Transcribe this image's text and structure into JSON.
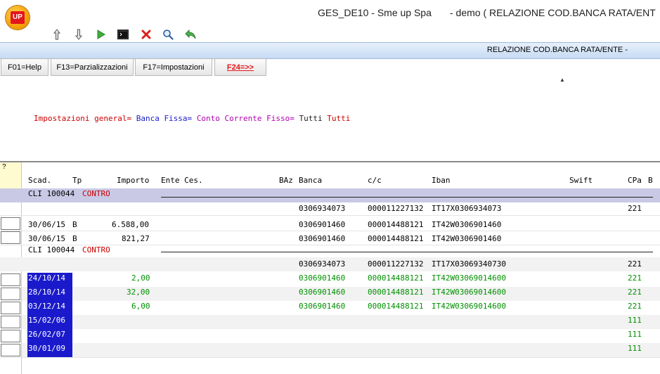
{
  "app": {
    "logo_text": "UP",
    "title": "GES_DE10 - Sme up Spa",
    "window_title": "- demo ( RELAZIONE COD.BANCA RATA/ENT"
  },
  "toolbar": {
    "icons": [
      "arrow-up-icon",
      "arrow-down-icon",
      "play-icon",
      "terminal-icon",
      "close-icon",
      "search-icon",
      "undo-icon"
    ]
  },
  "band": {
    "title": "RELAZIONE COD.BANCA RATA/ENTE -"
  },
  "function_keys": [
    "F01=Help",
    "F13=Parzializzazioni",
    "F17=Impostazioni",
    "F24=>>"
  ],
  "settings": {
    "label": "Impostazioni general=",
    "banca_label": "Banca Fissa=",
    "conto_label": "Conto Corrente Fisso=",
    "banca_value": "Tutti",
    "conto_value": "Tutti"
  },
  "grid": {
    "sel_header": "?",
    "columns": [
      "Scad.",
      "Tp",
      "Importo",
      "Ente Ces.",
      "BAz",
      "Banca",
      "c/c",
      "Iban",
      "Swift",
      "CPa",
      "B"
    ],
    "groups": [
      {
        "client": "CLI 100044",
        "tag": "CONTRO",
        "summary": {
          "banca": "0306934073",
          "cc": "000011227132",
          "iban": "IT17X0306934073",
          "cpa": "221"
        },
        "rows": [
          {
            "scad": "30/06/15",
            "tp": "B",
            "importo": "6.588,00",
            "banca": "0306901460",
            "cc": "000014488121",
            "iban": "IT42W0306901460",
            "cpa": ""
          },
          {
            "scad": "30/06/15",
            "tp": "B",
            "importo": "821,27",
            "banca": "0306901460",
            "cc": "000014488121",
            "iban": "IT42W0306901460",
            "cpa": ""
          }
        ]
      },
      {
        "client": "CLI 100044",
        "tag": "CONTRO",
        "summary": {
          "banca": "0306934073",
          "cc": "000011227132",
          "iban": "IT17X03069340730",
          "cpa": "221"
        },
        "rows": [
          {
            "scad": "24/10/14",
            "importo": "2,00",
            "banca": "0306901460",
            "cc": "000014488121",
            "iban": "IT42W03069014600",
            "cpa": "221"
          },
          {
            "scad": "28/10/14",
            "importo": "32,00",
            "banca": "0306901460",
            "cc": "000014488121",
            "iban": "IT42W03069014600",
            "cpa": "221"
          },
          {
            "scad": "03/12/14",
            "importo": "6,00",
            "banca": "0306901460",
            "cc": "000014488121",
            "iban": "IT42W03069014600",
            "cpa": "221"
          },
          {
            "scad": "15/02/06",
            "importo": "",
            "banca": "",
            "cc": "",
            "iban": "",
            "cpa": "111"
          },
          {
            "scad": "26/02/07",
            "importo": "",
            "banca": "",
            "cc": "",
            "iban": "",
            "cpa": "111"
          },
          {
            "scad": "30/01/09",
            "importo": "",
            "banca": "",
            "cc": "",
            "iban": "",
            "cpa": "111"
          }
        ]
      }
    ]
  },
  "colors": {
    "band": "#c6dbf3",
    "group_row": "#c9c9e6",
    "date_highlight": "#1a1acc",
    "value_green": "#009000",
    "settings_red": "#cc0000",
    "settings_blue": "#1a1acc",
    "settings_magenta": "#b000b0"
  }
}
